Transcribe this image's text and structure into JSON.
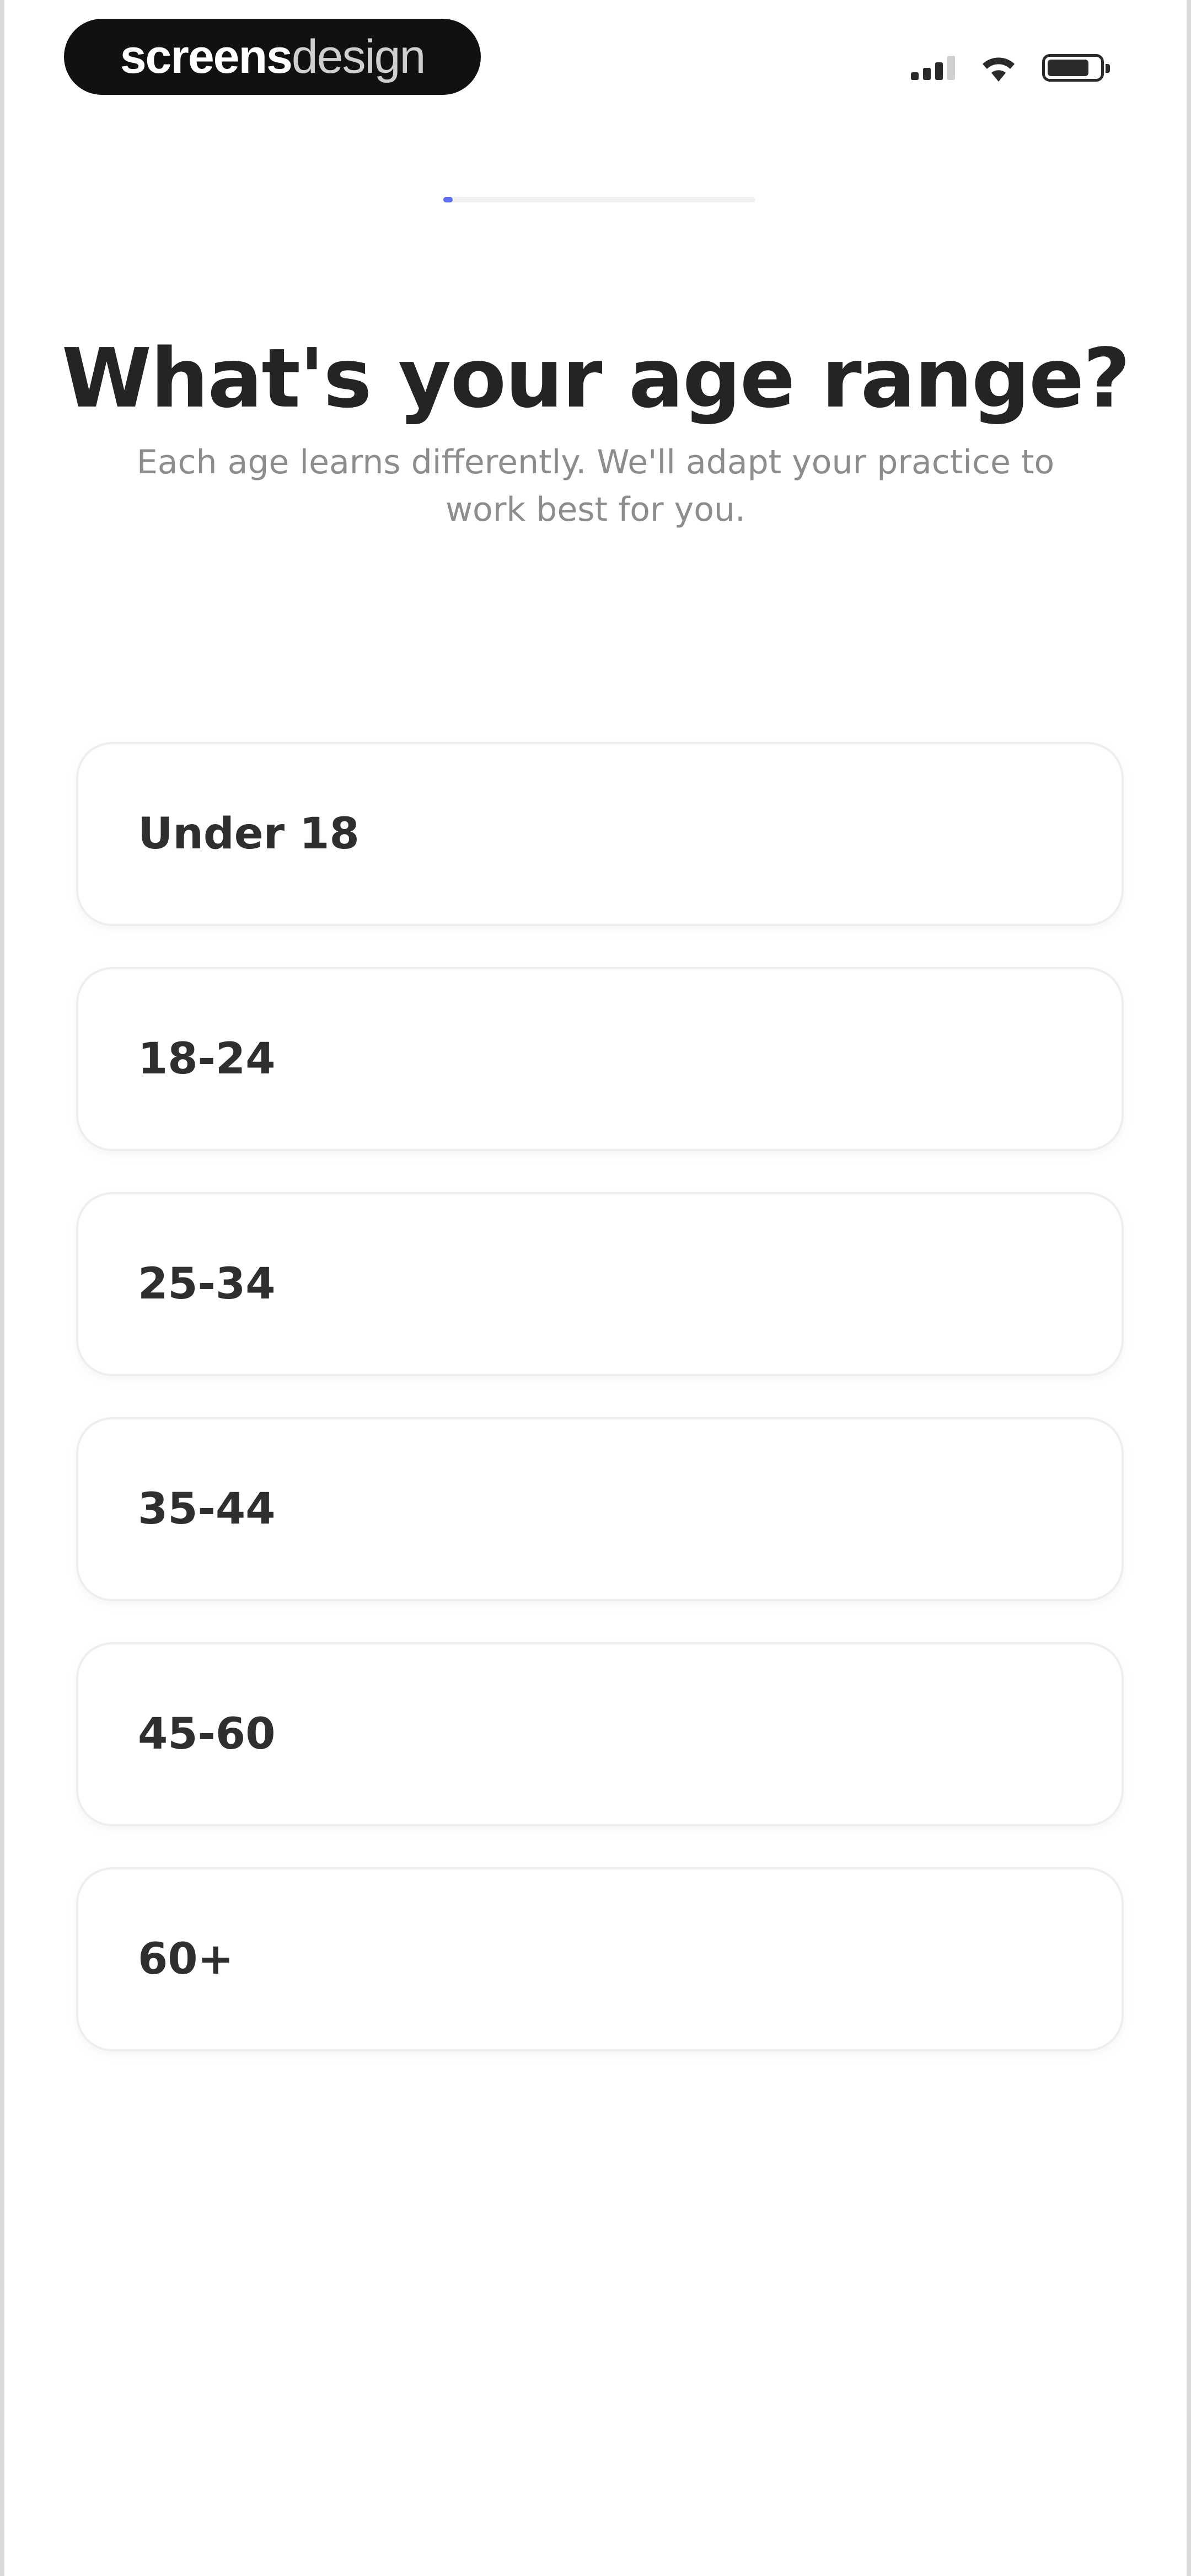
{
  "status_bar": {
    "brand": {
      "part1": "screens",
      "part2": "design"
    },
    "icons": [
      "signal-icon",
      "wifi-icon",
      "battery-icon"
    ]
  },
  "progress": {
    "fraction": 0.03,
    "color": "#5b6cf0"
  },
  "heading": {
    "title": "What's your age range?",
    "subtitle": "Each age learns differently. We'll adapt your practice to work best for you."
  },
  "options": [
    {
      "label": "Under 18"
    },
    {
      "label": "18-24"
    },
    {
      "label": "25-34"
    },
    {
      "label": "35-44"
    },
    {
      "label": "45-60"
    },
    {
      "label": "60+"
    }
  ]
}
